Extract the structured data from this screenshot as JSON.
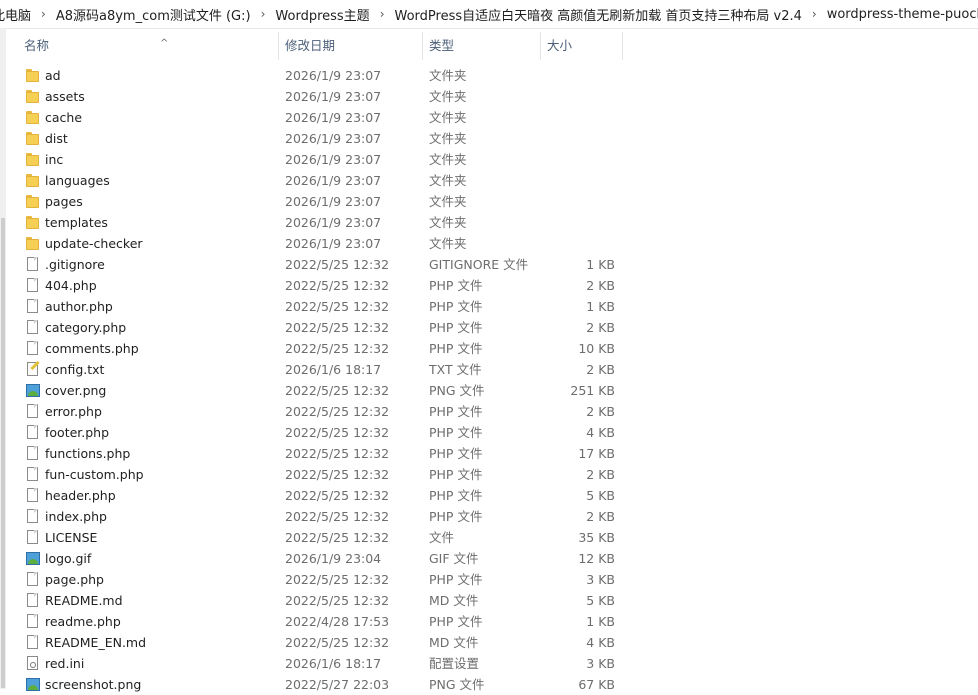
{
  "breadcrumb": [
    "此电脑",
    "A8源码a8ym_com测试文件 (G:)",
    "Wordpress主题",
    "WordPress自适应白天暗夜 高颜值无刷新加载 首页支持三种布局 v2.4",
    "wordpress-theme-puock-master"
  ],
  "columns": {
    "name": "名称",
    "date": "修改日期",
    "type": "类型",
    "size": "大小"
  },
  "sort_indicator": "^",
  "files": [
    {
      "name": "ad",
      "date": "2026/1/9 23:07",
      "type": "文件夹",
      "size": "",
      "icon": "folder-icon"
    },
    {
      "name": "assets",
      "date": "2026/1/9 23:07",
      "type": "文件夹",
      "size": "",
      "icon": "folder-icon"
    },
    {
      "name": "cache",
      "date": "2026/1/9 23:07",
      "type": "文件夹",
      "size": "",
      "icon": "folder-icon"
    },
    {
      "name": "dist",
      "date": "2026/1/9 23:07",
      "type": "文件夹",
      "size": "",
      "icon": "folder-icon"
    },
    {
      "name": "inc",
      "date": "2026/1/9 23:07",
      "type": "文件夹",
      "size": "",
      "icon": "folder-icon"
    },
    {
      "name": "languages",
      "date": "2026/1/9 23:07",
      "type": "文件夹",
      "size": "",
      "icon": "folder-icon"
    },
    {
      "name": "pages",
      "date": "2026/1/9 23:07",
      "type": "文件夹",
      "size": "",
      "icon": "folder-icon"
    },
    {
      "name": "templates",
      "date": "2026/1/9 23:07",
      "type": "文件夹",
      "size": "",
      "icon": "folder-icon"
    },
    {
      "name": "update-checker",
      "date": "2026/1/9 23:07",
      "type": "文件夹",
      "size": "",
      "icon": "folder-icon"
    },
    {
      "name": ".gitignore",
      "date": "2022/5/25 12:32",
      "type": "GITIGNORE 文件",
      "size": "1 KB",
      "icon": "file-icon"
    },
    {
      "name": "404.php",
      "date": "2022/5/25 12:32",
      "type": "PHP 文件",
      "size": "2 KB",
      "icon": "file-icon"
    },
    {
      "name": "author.php",
      "date": "2022/5/25 12:32",
      "type": "PHP 文件",
      "size": "1 KB",
      "icon": "file-icon"
    },
    {
      "name": "category.php",
      "date": "2022/5/25 12:32",
      "type": "PHP 文件",
      "size": "2 KB",
      "icon": "file-icon"
    },
    {
      "name": "comments.php",
      "date": "2022/5/25 12:32",
      "type": "PHP 文件",
      "size": "10 KB",
      "icon": "file-icon"
    },
    {
      "name": "config.txt",
      "date": "2026/1/6 18:17",
      "type": "TXT 文件",
      "size": "2 KB",
      "icon": "text-file-icon"
    },
    {
      "name": "cover.png",
      "date": "2022/5/25 12:32",
      "type": "PNG 文件",
      "size": "251 KB",
      "icon": "image-file-icon"
    },
    {
      "name": "error.php",
      "date": "2022/5/25 12:32",
      "type": "PHP 文件",
      "size": "2 KB",
      "icon": "file-icon"
    },
    {
      "name": "footer.php",
      "date": "2022/5/25 12:32",
      "type": "PHP 文件",
      "size": "4 KB",
      "icon": "file-icon"
    },
    {
      "name": "functions.php",
      "date": "2022/5/25 12:32",
      "type": "PHP 文件",
      "size": "17 KB",
      "icon": "file-icon"
    },
    {
      "name": "fun-custom.php",
      "date": "2022/5/25 12:32",
      "type": "PHP 文件",
      "size": "2 KB",
      "icon": "file-icon"
    },
    {
      "name": "header.php",
      "date": "2022/5/25 12:32",
      "type": "PHP 文件",
      "size": "5 KB",
      "icon": "file-icon"
    },
    {
      "name": "index.php",
      "date": "2022/5/25 12:32",
      "type": "PHP 文件",
      "size": "2 KB",
      "icon": "file-icon"
    },
    {
      "name": "LICENSE",
      "date": "2022/5/25 12:32",
      "type": "文件",
      "size": "35 KB",
      "icon": "file-icon"
    },
    {
      "name": "logo.gif",
      "date": "2026/1/9 23:04",
      "type": "GIF 文件",
      "size": "12 KB",
      "icon": "image-file-icon"
    },
    {
      "name": "page.php",
      "date": "2022/5/25 12:32",
      "type": "PHP 文件",
      "size": "3 KB",
      "icon": "file-icon"
    },
    {
      "name": "README.md",
      "date": "2022/5/25 12:32",
      "type": "MD 文件",
      "size": "5 KB",
      "icon": "file-icon"
    },
    {
      "name": "readme.php",
      "date": "2022/4/28 17:53",
      "type": "PHP 文件",
      "size": "1 KB",
      "icon": "file-icon"
    },
    {
      "name": "README_EN.md",
      "date": "2022/5/25 12:32",
      "type": "MD 文件",
      "size": "4 KB",
      "icon": "file-icon"
    },
    {
      "name": "red.ini",
      "date": "2026/1/6 18:17",
      "type": "配置设置",
      "size": "3 KB",
      "icon": "config-file-icon"
    },
    {
      "name": "screenshot.png",
      "date": "2022/5/27 22:03",
      "type": "PNG 文件",
      "size": "67 KB",
      "icon": "image-file-icon"
    }
  ]
}
